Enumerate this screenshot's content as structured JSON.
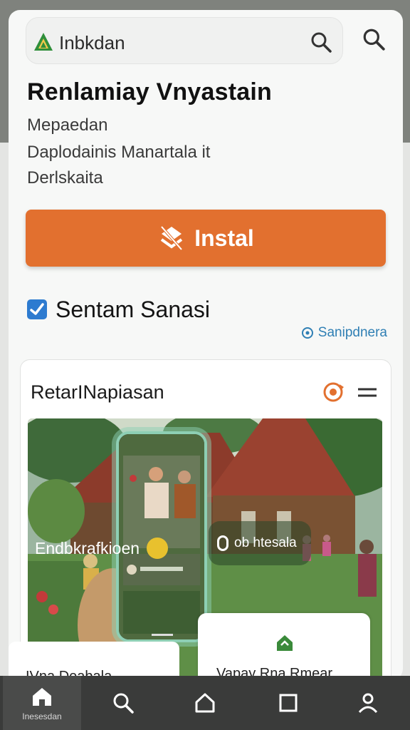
{
  "header": {
    "brand": "Inbkdan",
    "search_icon": "search-icon"
  },
  "app": {
    "title": "Renlamiay Vnyastain",
    "subtitle_1": "Mepaedan",
    "subtitle_2": "Daplodainis Manartala it",
    "subtitle_3": "Derlskaita",
    "install_label": "Instal"
  },
  "section": {
    "title": "Sentam Sanasi",
    "link_label": "Sanipdnera"
  },
  "card": {
    "title": "RetarINapiasan",
    "chip_left": "Endbkrafkioen",
    "chip_right": "ob htesala",
    "mini_left": "IVna Deabala",
    "mini_right": "Vapay Rna Rmear"
  },
  "bottom_nav": {
    "home_label": "Inesesdan"
  },
  "colors": {
    "accent": "#e2702f",
    "link": "#2f7fb4",
    "brand_green": "#3a8a3a"
  }
}
